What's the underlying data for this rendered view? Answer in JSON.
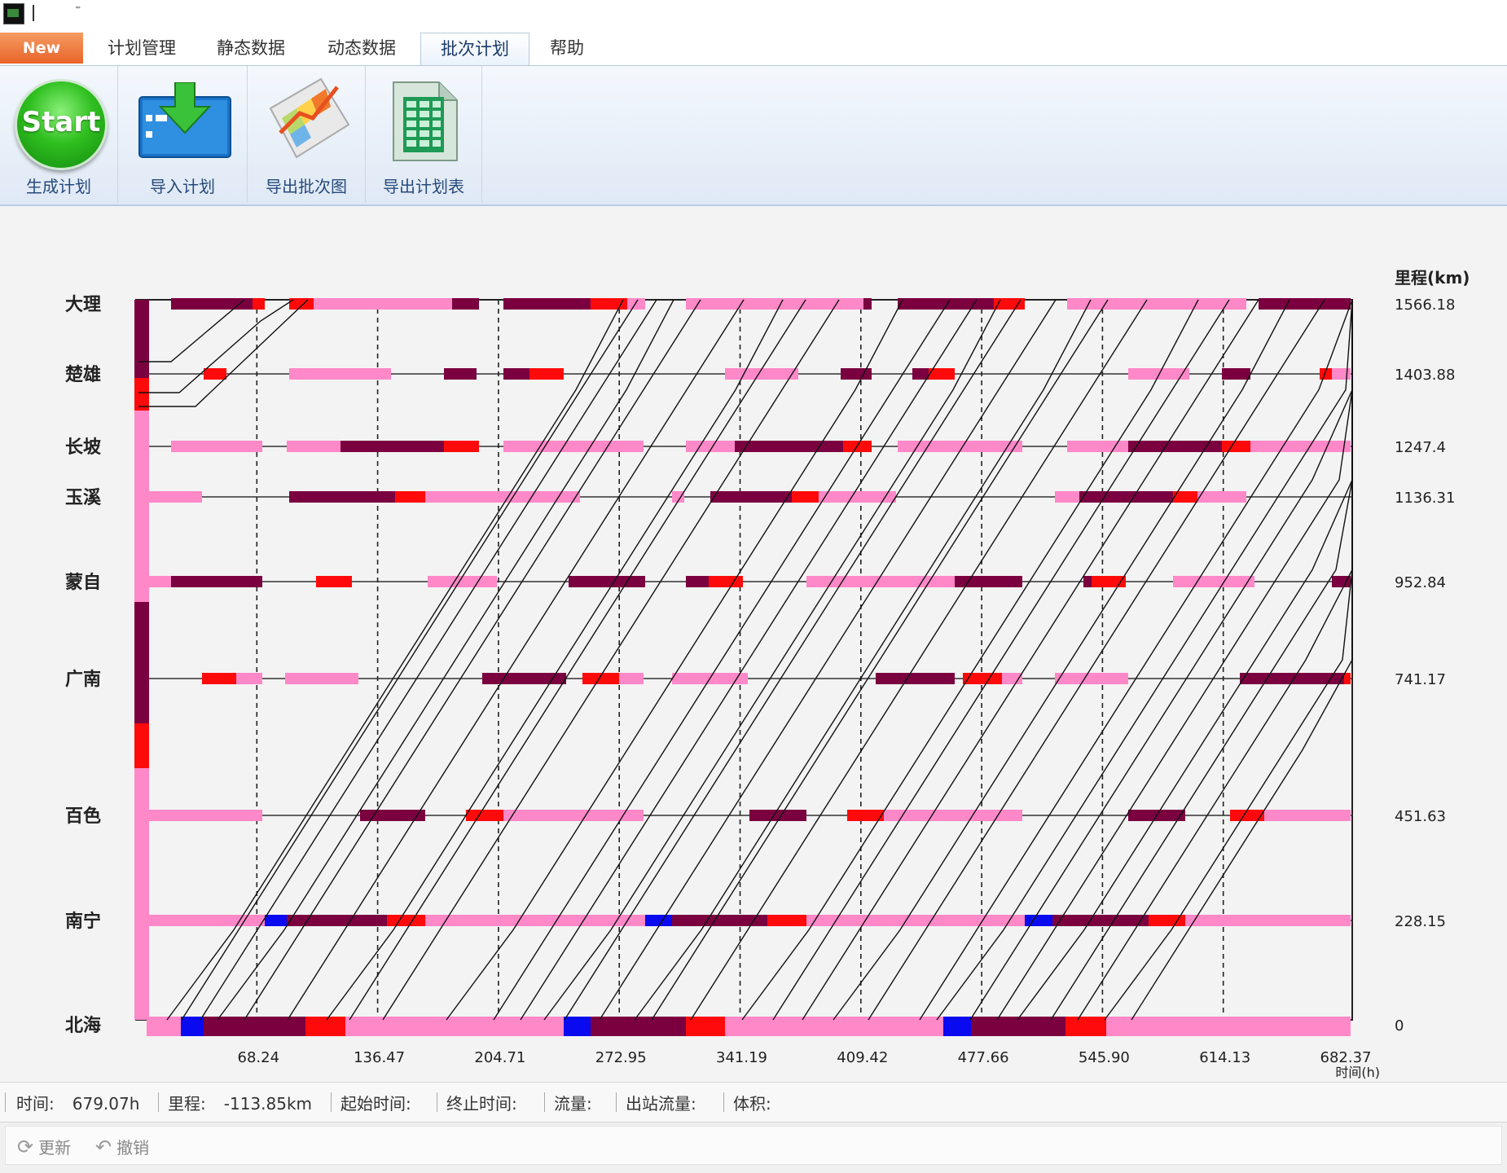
{
  "ribbon_tabs": {
    "file": "New",
    "items": [
      "计划管理",
      "静态数据",
      "动态数据",
      "批次计划",
      "帮助"
    ],
    "active": "批次计划"
  },
  "ribbon_buttons": {
    "start_icon_text": "Start",
    "generate_plan": "生成计划",
    "import_plan": "导入计划",
    "export_graph": "导出批次图",
    "export_table": "导出计划表"
  },
  "chart_data": {
    "type": "line",
    "unit_right": "里程(km)",
    "x_axis_label": "时间(h)",
    "stations": [
      {
        "name": "大理",
        "km": "1566.18"
      },
      {
        "name": "楚雄",
        "km": "1403.88"
      },
      {
        "name": "长坡",
        "km": "1247.4"
      },
      {
        "name": "玉溪",
        "km": "1136.31"
      },
      {
        "name": "蒙自",
        "km": "952.84"
      },
      {
        "name": "广南",
        "km": "741.17"
      },
      {
        "name": "百色",
        "km": "451.63"
      },
      {
        "name": "南宁",
        "km": "228.15"
      },
      {
        "name": "北海",
        "km": "0"
      }
    ],
    "x_ticks": [
      "68.24",
      "136.47",
      "204.71",
      "272.95",
      "341.19",
      "409.42",
      "477.66",
      "545.90",
      "614.13",
      "682.37"
    ],
    "x_max": 682.37,
    "colors": {
      "pink": "#ff88c8",
      "dark": "#7b0040",
      "red": "#ff0a0a",
      "blue": "#0a0af0",
      "line": "#111111"
    }
  },
  "status": {
    "time_label": "时间:",
    "time_value": "679.07h",
    "mileage_label": "里程:",
    "mileage_value": "-113.85km",
    "start_label": "起始时间:",
    "end_label": "终止时间:",
    "flow_label": "流量:",
    "out_flow_label": "出站流量:",
    "volume_label": "体积:"
  },
  "bottom": {
    "refresh": "更新",
    "undo": "撤销"
  }
}
